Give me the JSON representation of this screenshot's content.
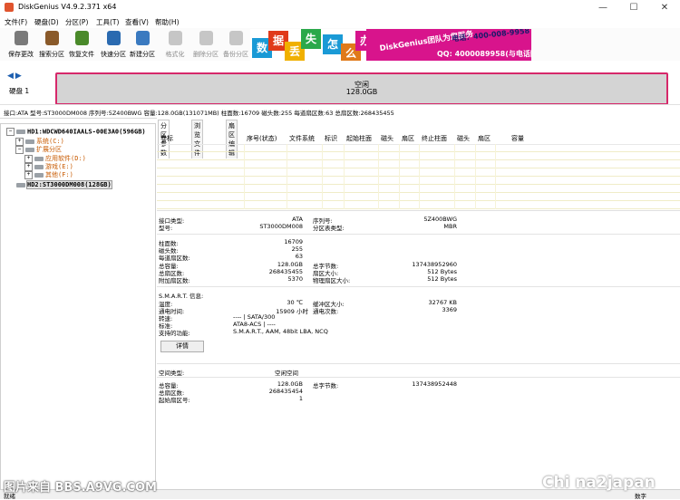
{
  "title_bar": {
    "title": "DiskGenius V4.9.2.371 x64",
    "min": "—",
    "max": "☐",
    "close": "✕"
  },
  "menu": [
    "文件(F)",
    "硬盘(D)",
    "分区(P)",
    "工具(T)",
    "查看(V)",
    "帮助(H)"
  ],
  "toolbar": [
    {
      "label": "保存更改",
      "icon": "save-icon",
      "color": "#7a7a7a",
      "enabled": true
    },
    {
      "label": "搜索分区",
      "icon": "magnifier-icon",
      "color": "#8a5a2a",
      "enabled": true
    },
    {
      "label": "恢复文件",
      "icon": "recover-box-icon",
      "color": "#4a8a2a",
      "enabled": true
    },
    {
      "label": "快速分区",
      "icon": "quick-partition-icon",
      "color": "#2a6ab0",
      "enabled": true
    },
    {
      "label": "新建分区",
      "icon": "new-partition-icon",
      "color": "#3a7ac0",
      "enabled": true
    },
    {
      "label": "格式化",
      "icon": "format-icon",
      "color": "#9a9a9a",
      "enabled": false
    },
    {
      "label": "删除分区",
      "icon": "trash-icon",
      "color": "#9a9a9a",
      "enabled": false
    },
    {
      "label": "备份分区",
      "icon": "backup-icon",
      "color": "#9a9a9a",
      "enabled": false
    }
  ],
  "banner": {
    "tiles": [
      {
        "char": "数",
        "color": "#1a9ad6"
      },
      {
        "char": "据",
        "color": "#e03a1a"
      },
      {
        "char": "丢",
        "color": "#f0b000"
      },
      {
        "char": "失",
        "color": "#2aa84a"
      },
      {
        "char": "怎",
        "color": "#1a9ad6"
      },
      {
        "char": "么",
        "color": "#e07a1a"
      },
      {
        "char": "办",
        "color": "#d6148c"
      }
    ],
    "team": "DiskGenius团队为您服务",
    "phone": "电话：400-008-9958",
    "qq": "QQ: 4000089958(与电话同号)"
  },
  "disk_panel": {
    "disk_label": "硬盘 1",
    "partition_name": "空闲",
    "partition_size": "128.0GB"
  },
  "disk_info": "接口:ATA  型号:ST3000DM008  序列号:5Z400BWG  容量:128.0GB(131071MB)  柱面数:16709  磁头数:255  每道扇区数:63  总扇区数:268435455",
  "tree": [
    {
      "text": "HD1:WDCWD640IAALS-00E3A0(596GB)",
      "exp": "−",
      "indent": 0,
      "style": "bold"
    },
    {
      "text": "系统(C:)",
      "exp": "+",
      "indent": 1,
      "style": "orange"
    },
    {
      "text": "扩展分区",
      "exp": "−",
      "indent": 1,
      "style": "orange"
    },
    {
      "text": "应用软件(D:)",
      "exp": "+",
      "indent": 2,
      "style": "orange"
    },
    {
      "text": "游戏(E:)",
      "exp": "+",
      "indent": 2,
      "style": "orange"
    },
    {
      "text": "其他(F:)",
      "exp": "+",
      "indent": 2,
      "style": "orange"
    },
    {
      "text": "HD2:ST3000DM008(128GB)",
      "exp": "",
      "indent": 0,
      "style": "selected"
    }
  ],
  "tabs": [
    "分区参数",
    "浏览文件",
    "扇区编辑"
  ],
  "table_headers": [
    "卷标",
    "序号(状态)",
    "文件系统",
    "标识",
    "起始柱面",
    "磁头",
    "扇区",
    "终止柱面",
    "磁头",
    "扇区",
    "容量"
  ],
  "details": {
    "interface": {
      "label": "接口类型:",
      "value": "ATA"
    },
    "model": {
      "label": "型号:",
      "value": "ST3000DM008"
    },
    "serial": {
      "label": "序列号:",
      "value": "5Z400BWG"
    },
    "table_type": {
      "label": "分区表类型:",
      "value": "MBR"
    },
    "cylinders": {
      "label": "柱面数:",
      "value": "16709"
    },
    "heads": {
      "label": "磁头数:",
      "value": "255"
    },
    "spt": {
      "label": "每道扇区数:",
      "value": "63"
    },
    "capacity": {
      "label": "总容量:",
      "value": "128.0GB"
    },
    "total_bytes": {
      "label": "总字节数:",
      "value": "137438952960"
    },
    "total_sectors": {
      "label": "总扇区数:",
      "value": "268435455"
    },
    "sector_size": {
      "label": "扇区大小:",
      "value": "512 Bytes"
    },
    "extra_sectors": {
      "label": "附加扇区数:",
      "value": "5370"
    },
    "phys_sector": {
      "label": "物理扇区大小:",
      "value": "512 Bytes"
    }
  },
  "smart": {
    "title": "S.M.A.R.T. 信息:",
    "temp": {
      "label": "温度:",
      "value": "30 ℃"
    },
    "buffer": {
      "label": "缓冲区大小:",
      "value": "32767 KB"
    },
    "power_hours": {
      "label": "通电时间:",
      "value": "15909 小时"
    },
    "power_count": {
      "label": "通电次数:",
      "value": "3369"
    },
    "rpm": {
      "label": "转速:",
      "value": "---- | SATA/300"
    },
    "standard": {
      "label": "标准:",
      "value": "ATA8-ACS | ----"
    },
    "features": {
      "label": "支持的功能:",
      "value": "S.M.A.R.T., AAM, 48bit LBA, NCQ"
    },
    "button": "详情"
  },
  "free_space": {
    "type": {
      "label": "空间类型:",
      "value": "空闲空间"
    },
    "capacity": {
      "label": "总容量:",
      "value": "128.0GB"
    },
    "total_bytes": {
      "label": "总字节数:",
      "value": "137438952448"
    },
    "total_sectors": {
      "label": "总扇区数:",
      "value": "268435454"
    },
    "start_sector": {
      "label": "起始扇区号:",
      "value": "1"
    }
  },
  "status": {
    "left": "就绪",
    "right": "数字"
  },
  "watermarks": {
    "left": "图片来自 BBS.A9VG.COM",
    "right": "Chi na2japan"
  }
}
